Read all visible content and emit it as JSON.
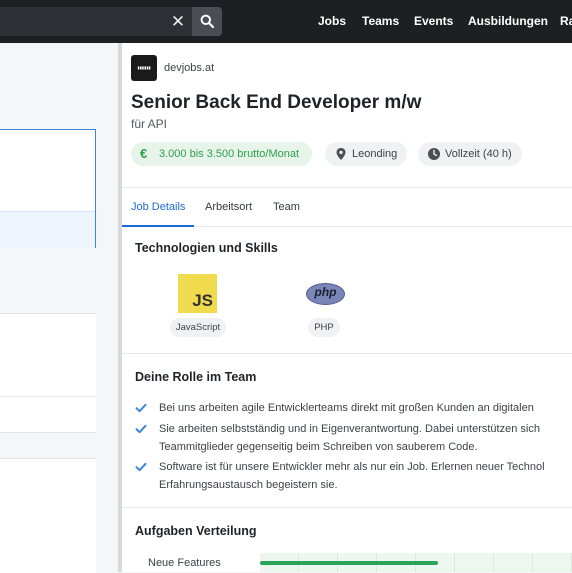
{
  "colors": {
    "topbar": "#1d1f23",
    "accent": "#1b6ad6",
    "salary_green": "#2f9e4c",
    "check_blue": "#3a86d8",
    "bar_green": "#2aa45a"
  },
  "nav": {
    "items": [
      "Jobs",
      "Teams",
      "Events",
      "Ausbildungen",
      "Ra"
    ]
  },
  "job": {
    "company": "devjobs.at",
    "title": "Senior Back End Developer m/w",
    "subtitle": "für API",
    "salary": "3.000 bis 3.500 brutto/Monat",
    "location": "Leonding",
    "employment": "Vollzeit (40 h)"
  },
  "tabs": [
    "Job Details",
    "Arbeitsort",
    "Team"
  ],
  "skills": {
    "heading": "Technologien und Skills",
    "items": [
      {
        "name": "JavaScript",
        "logo": "JS"
      },
      {
        "name": "PHP",
        "logo": "php"
      }
    ]
  },
  "role": {
    "heading": "Deine Rolle im Team",
    "lines": [
      "Bei uns arbeiten agile Entwicklerteams direkt mit großen Kunden an digitalen",
      "Sie arbeiten selbstständig und in Eigenverantwortung. Dabei unterstützen sich",
      "Teammitglieder gegenseitig beim Schreiben von sauberem Code.",
      "Software ist für unsere Entwickler mehr als nur ein Job. Erlernen neuer Technol",
      "Erfahrungsaustausch begeistern sie."
    ]
  },
  "tasks": {
    "heading": "Aufgaben Verteilung",
    "rows": [
      {
        "label": "Neue Features",
        "share": 0.57
      }
    ]
  }
}
